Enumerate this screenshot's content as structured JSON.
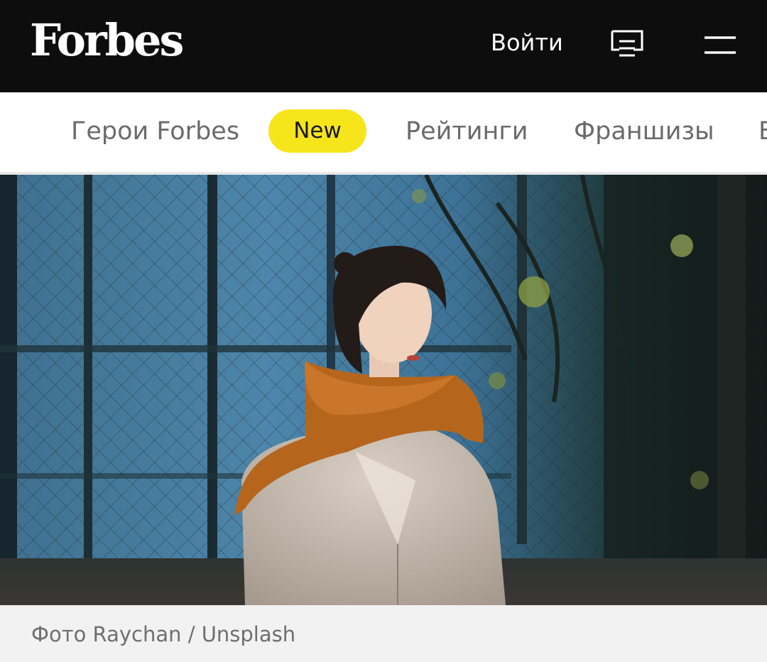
{
  "header": {
    "logo_text": "Forbes",
    "login_label": "Войти",
    "icons": [
      "menu-list-icon",
      "hamburger-menu-icon"
    ]
  },
  "nav": {
    "items": [
      {
        "label": "Герои Forbes"
      },
      {
        "label": "New",
        "badge": true,
        "badge_color": "#f7e51c"
      },
      {
        "label": "Рейтинги"
      },
      {
        "label": "Франшизы"
      },
      {
        "label": "Б"
      }
    ]
  },
  "hero_image": {
    "caption": "Фото Raychan / Unsplash"
  },
  "colors": {
    "header_bg": "#0d0d0d",
    "badge": "#f7e51c",
    "caption_bg": "#f2f2f2"
  }
}
